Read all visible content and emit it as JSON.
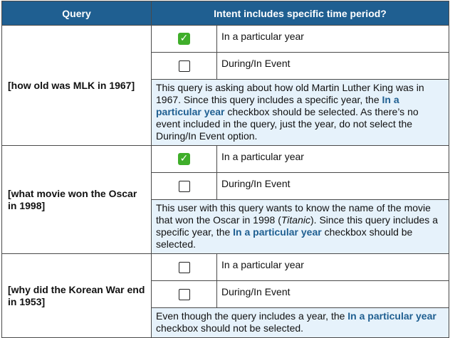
{
  "headers": {
    "query": "Query",
    "intent": "Intent includes specific time period?"
  },
  "rows": [
    {
      "query": "[how old was MLK in 1967]",
      "options": [
        {
          "label": "In a particular year",
          "checked": true
        },
        {
          "label": "During/In Event",
          "checked": false
        }
      ],
      "explanation": {
        "pre": "This query is asking about how old Martin Luther King was in 1967. Since this query includes a specific year, the ",
        "highlight": "In a particular year",
        "post": " checkbox should be selected. As there’s no event included in the query, just the year, do not select the During/In Event option."
      }
    },
    {
      "query": "[what movie won the Oscar in 1998]",
      "options": [
        {
          "label": "In a particular year",
          "checked": true
        },
        {
          "label": "During/In Event",
          "checked": false
        }
      ],
      "explanation": {
        "pre": "This user with this query wants to know the name of the movie that won the Oscar in 1998 (",
        "italic": "Titanic",
        "mid": "). Since this query includes a specific year, the ",
        "highlight": "In a particular year",
        "post": " checkbox should be selected."
      }
    },
    {
      "query": "[why did the Korean War end in 1953]",
      "options": [
        {
          "label": "In a particular year",
          "checked": false
        },
        {
          "label": "During/In Event",
          "checked": false
        }
      ],
      "explanation": {
        "pre": "Even though the query includes a year, the ",
        "highlight": "In a particular year",
        "post": " checkbox should not be selected."
      }
    }
  ],
  "icons": {
    "checked": "green-checkmark-icon",
    "unchecked": "empty-checkbox-icon"
  },
  "colors": {
    "header_bg": "#1f5f91",
    "explanation_bg": "#e6f2fb",
    "highlight": "#1f5f91",
    "check_green": "#3fae2a"
  }
}
